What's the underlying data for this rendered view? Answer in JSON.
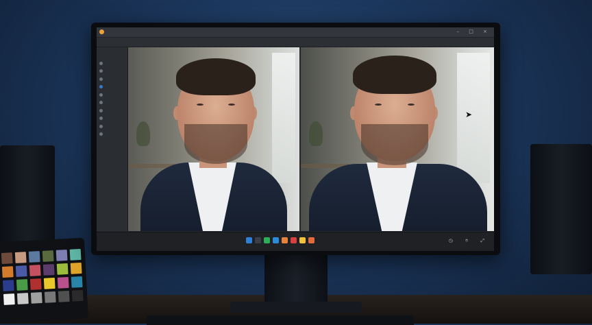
{
  "window": {
    "app_title": "",
    "window_controls": "– □ ×"
  },
  "toolbar": {
    "tools": []
  },
  "sidebar": {
    "header": "",
    "items": [
      {
        "label": "",
        "dot": "#6e737b"
      },
      {
        "label": "",
        "dot": "#6e737b"
      },
      {
        "label": "",
        "dot": "#6e737b"
      },
      {
        "label": "",
        "dot": "#3a78c8"
      },
      {
        "label": "",
        "dot": "#6e737b"
      },
      {
        "label": "",
        "dot": "#6e737b"
      },
      {
        "label": "",
        "dot": "#6e737b"
      },
      {
        "label": "",
        "dot": "#6e737b"
      },
      {
        "label": "",
        "dot": "#6e737b"
      },
      {
        "label": "",
        "dot": "#6e737b"
      }
    ]
  },
  "panels": {
    "before": {
      "image": "portrait-original"
    },
    "after": {
      "image": "portrait-retouched"
    }
  },
  "statusbar": {
    "left": "",
    "right": "◷ ⌾ ⤢"
  },
  "dock": {
    "icons": [
      {
        "name": "browser-icon",
        "color": "#2f7fd6"
      },
      {
        "name": "files-icon",
        "color": "#3a3f47"
      },
      {
        "name": "chat-icon",
        "color": "#2cae5a"
      },
      {
        "name": "store-icon",
        "color": "#2a8cd8"
      },
      {
        "name": "photos-icon",
        "color": "#e7823a"
      },
      {
        "name": "calendar-icon",
        "color": "#d94141"
      },
      {
        "name": "notes-icon",
        "color": "#f2c23a"
      },
      {
        "name": "paint-icon",
        "color": "#e36a3a"
      }
    ]
  },
  "checker": {
    "label": "",
    "patches": [
      "#6e4a3a",
      "#c79a82",
      "#5c7aa0",
      "#586a3e",
      "#7d7fb0",
      "#5fb7a6",
      "#d47a2c",
      "#4a5aa6",
      "#c45060",
      "#5c3c6a",
      "#9cbc3c",
      "#e0a62a",
      "#2c3c8c",
      "#4a9a48",
      "#b03030",
      "#e8c82a",
      "#b8508c",
      "#2a84a8",
      "#f0f0f0",
      "#c8c8c8",
      "#a0a0a0",
      "#787878",
      "#505050",
      "#2a2a2a"
    ]
  },
  "colors": {
    "wall": "#1b355a",
    "accent": "#f0a23a"
  }
}
